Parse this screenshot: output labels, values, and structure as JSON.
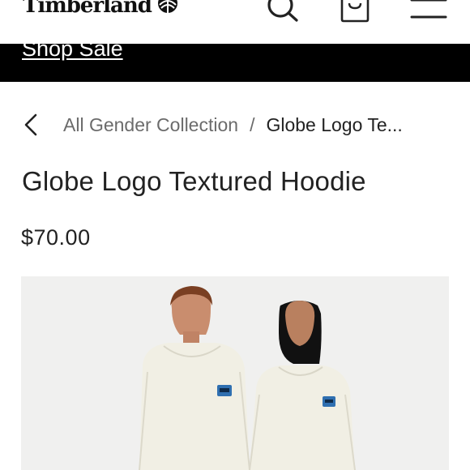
{
  "header": {
    "brand": "Timberland",
    "icons": [
      "tree-logo-icon",
      "search-icon",
      "shopping-bag-icon",
      "hamburger-menu-icon"
    ]
  },
  "promo": {
    "link_text": "Shop Sale"
  },
  "breadcrumb": {
    "parent": "All Gender Collection",
    "separator": "/",
    "current": "Globe Logo Te..."
  },
  "product": {
    "title": "Globe Logo Textured Hoodie",
    "price": "$70.00"
  },
  "colors": {
    "promo_bg": "#000000",
    "text": "#222222",
    "muted": "#6b6b6b",
    "photo_bg": "#f0f0ef",
    "hoodie": "#f1efe4"
  }
}
